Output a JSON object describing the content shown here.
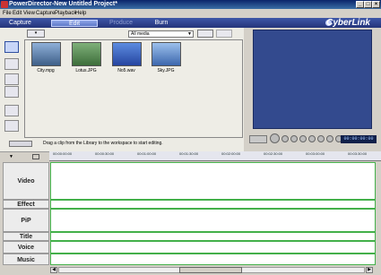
{
  "window": {
    "title": "PowerDirector-New Untitled Project*"
  },
  "menu": [
    "File",
    "Edit",
    "View",
    "Capture",
    "Playback",
    "Help"
  ],
  "modes": [
    "Capture",
    "Edit",
    "Produce",
    "Burn"
  ],
  "brand": "CyberLink",
  "library": {
    "filter": "All media",
    "items": [
      {
        "label": "City.mpg",
        "color": "#5e7aa0"
      },
      {
        "label": "Lotus.JPG",
        "color": "#5f8c5e"
      },
      {
        "label": "No5.wav",
        "color": "#3a5fb5"
      },
      {
        "label": "Sky.JPG",
        "color": "#4d77b8"
      }
    ]
  },
  "hint": "Drag a clip from the Library to the workspace to start editing.",
  "preview": {
    "timecode": "00:00:00:00"
  },
  "timeline": {
    "ruler": [
      "00:00:00:00",
      "00:00:30:00",
      "00:01:00:00",
      "00:01:30:00",
      "00:02:00:00",
      "00:02:30:00",
      "00:03:00:00",
      "00:03:30:00"
    ],
    "tracks": [
      "Video",
      "Effect",
      "PiP",
      "Title",
      "Voice",
      "Music"
    ]
  }
}
